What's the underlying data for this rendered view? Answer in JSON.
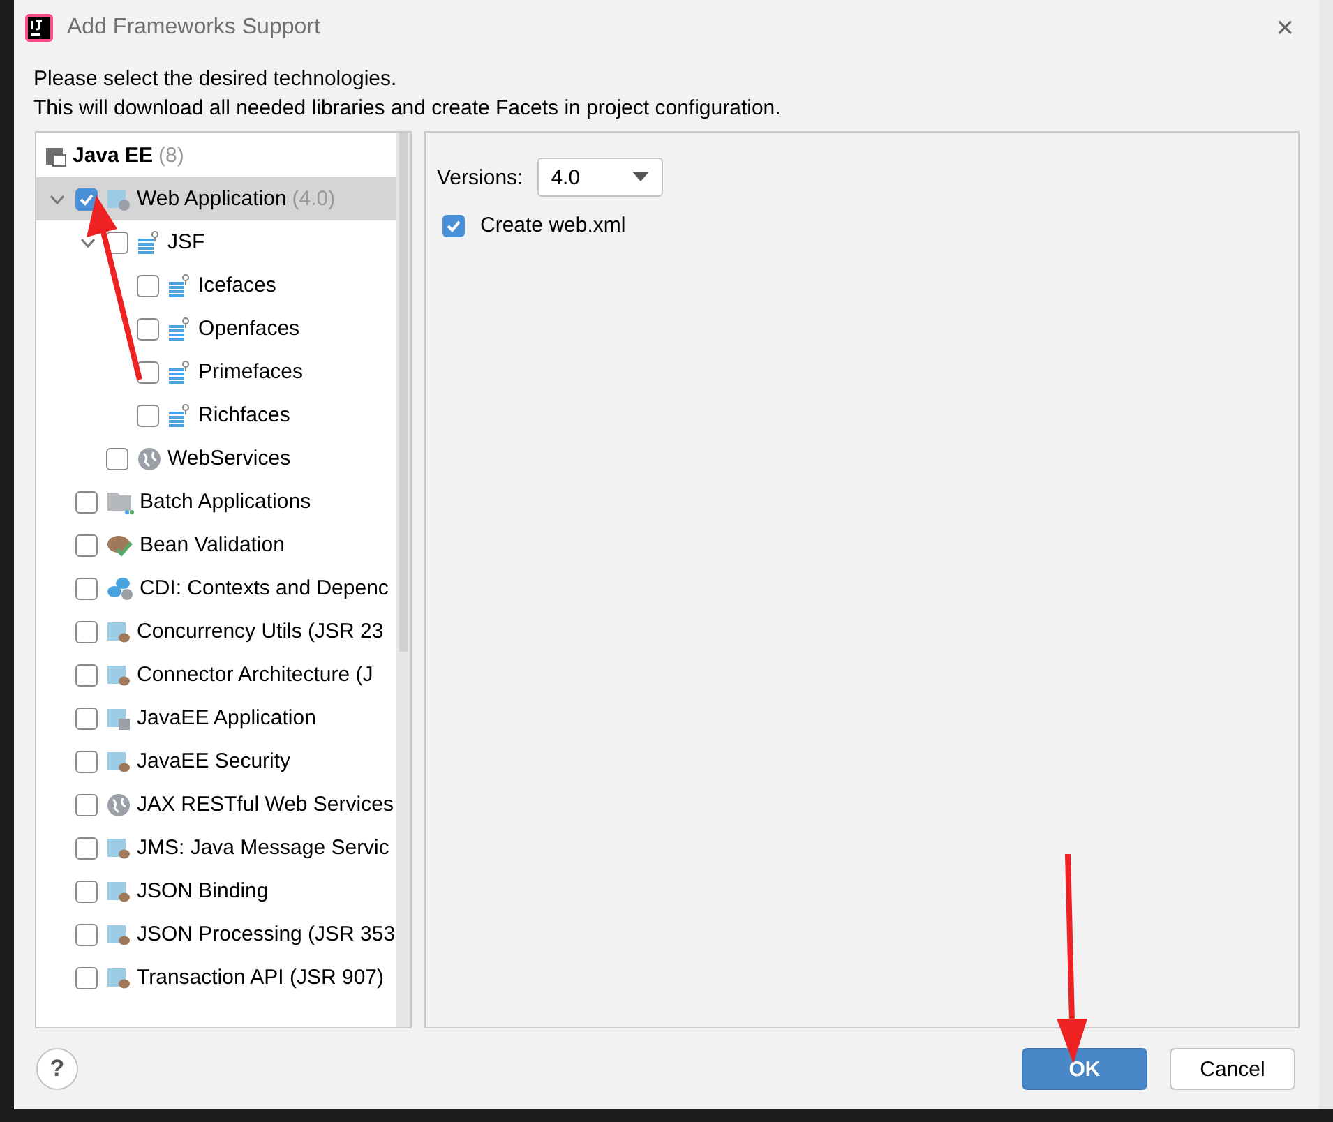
{
  "window": {
    "title": "Add Frameworks Support",
    "close": "×"
  },
  "intro": [
    "Please select the desired technologies.",
    "This will download all needed libraries and create Facets in project configuration."
  ],
  "tree": [
    {
      "label": "Java EE",
      "count": "(8)",
      "kind": "ee",
      "children": [
        {
          "label": "Web Application",
          "count": "(4.0)",
          "kind": "web",
          "checked": true,
          "selected": true,
          "expanded": true,
          "children": [
            {
              "label": "JSF",
              "kind": "jsf",
              "checked": false,
              "selected": false,
              "expanded": true,
              "children": [
                {
                  "label": "Icefaces",
                  "kind": "jsf",
                  "checked": false,
                  "selected": false
                },
                {
                  "label": "Openfaces",
                  "kind": "jsf",
                  "checked": false,
                  "selected": false
                },
                {
                  "label": "Primefaces",
                  "kind": "jsf",
                  "checked": false,
                  "selected": false
                },
                {
                  "label": "Richfaces",
                  "kind": "jsf",
                  "checked": false,
                  "selected": false
                }
              ]
            },
            {
              "label": "WebServices",
              "kind": "globe",
              "checked": false,
              "selected": false
            }
          ]
        },
        {
          "label": "Batch Applications",
          "kind": "folder",
          "checked": false,
          "selected": false
        },
        {
          "label": "Bean Validation",
          "kind": "bean",
          "checked": false,
          "selected": false
        },
        {
          "label": "CDI: Contexts and Depenc",
          "kind": "cdi",
          "checked": false,
          "selected": false
        },
        {
          "label": "Concurrency Utils (JSR 23",
          "kind": "module",
          "checked": false,
          "selected": false
        },
        {
          "label": "Connector Architecture (J",
          "kind": "module",
          "checked": false,
          "selected": false
        },
        {
          "label": "JavaEE Application",
          "kind": "app",
          "checked": false,
          "selected": false
        },
        {
          "label": "JavaEE Security",
          "kind": "module",
          "checked": false,
          "selected": false
        },
        {
          "label": "JAX RESTful Web Services",
          "kind": "globe",
          "checked": false,
          "selected": false
        },
        {
          "label": "JMS: Java Message Servic",
          "kind": "module",
          "checked": false,
          "selected": false
        },
        {
          "label": "JSON Binding",
          "kind": "module",
          "checked": false,
          "selected": false
        },
        {
          "label": "JSON Processing (JSR 353",
          "kind": "module",
          "checked": false,
          "selected": false
        },
        {
          "label": "Transaction API (JSR 907)",
          "kind": "module",
          "checked": false,
          "selected": false
        }
      ]
    }
  ],
  "details": {
    "versions_label": "Versions:",
    "version": "4.0",
    "create_web_xml": {
      "label": "Create web.xml",
      "checked": true
    }
  },
  "footer": {
    "help": "?",
    "buttons": [
      {
        "label": "OK",
        "kind": "primary"
      },
      {
        "label": "Cancel",
        "kind": "secondary"
      }
    ]
  }
}
